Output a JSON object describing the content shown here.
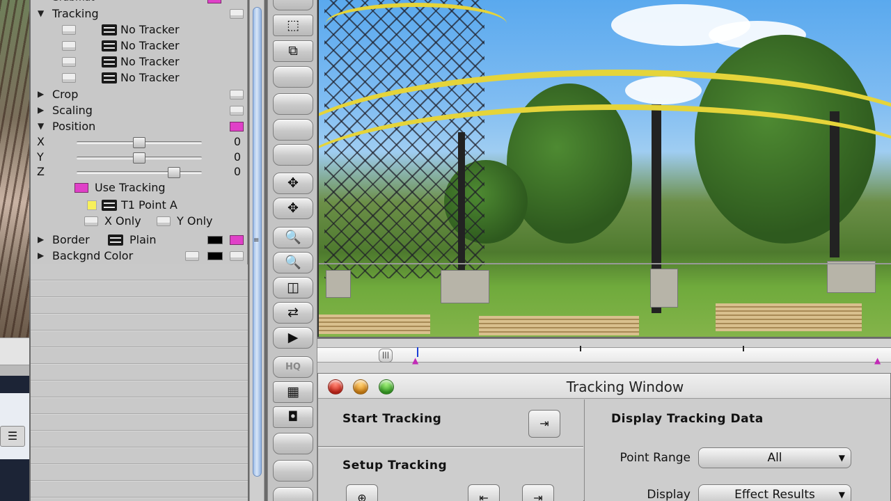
{
  "panel": {
    "top_row_label": "Grabmat",
    "tracking": {
      "label": "Tracking",
      "trackers": [
        "No Tracker",
        "No Tracker",
        "No Tracker",
        "No Tracker"
      ]
    },
    "crop": {
      "label": "Crop"
    },
    "scaling": {
      "label": "Scaling"
    },
    "position": {
      "label": "Position",
      "x": {
        "label": "X",
        "value": "0",
        "slider_fraction": 0.5
      },
      "y": {
        "label": "Y",
        "value": "0",
        "slider_fraction": 0.5
      },
      "z": {
        "label": "Z",
        "value": "0",
        "slider_fraction": 0.78
      },
      "use_tracking_label": "Use Tracking",
      "tracker_point": "T1 Point A",
      "x_only_label": "X Only",
      "y_only_label": "Y Only"
    },
    "border": {
      "label": "Border",
      "style": "Plain"
    },
    "backgnd_color": {
      "label": "Backgnd Color"
    }
  },
  "tools": {
    "hq_label": "HQ",
    "icons": [
      "marquee-icon",
      "reduce-icon",
      "move-icon",
      "move-all-icon",
      "zoom-out-icon",
      "zoom-in-icon",
      "split-icon",
      "swap-icon",
      "play-icon",
      "tracker-grid-icon",
      "frame-icon"
    ]
  },
  "timeline": {
    "scrub_glyph": "|||",
    "marker_glyph": "▲"
  },
  "tracking_window": {
    "title": "Tracking Window",
    "start_tracking": "Start Tracking",
    "setup_tracking": "Setup Tracking",
    "display_tracking_data": "Display Tracking Data",
    "point_range_label": "Point Range",
    "point_range_value": "All",
    "display_label": "Display",
    "display_value": "Effect Results"
  },
  "colors": {
    "magenta": "#e040c8",
    "yellow": "#f7f05a",
    "accent_blue": "#1a3fd6"
  }
}
